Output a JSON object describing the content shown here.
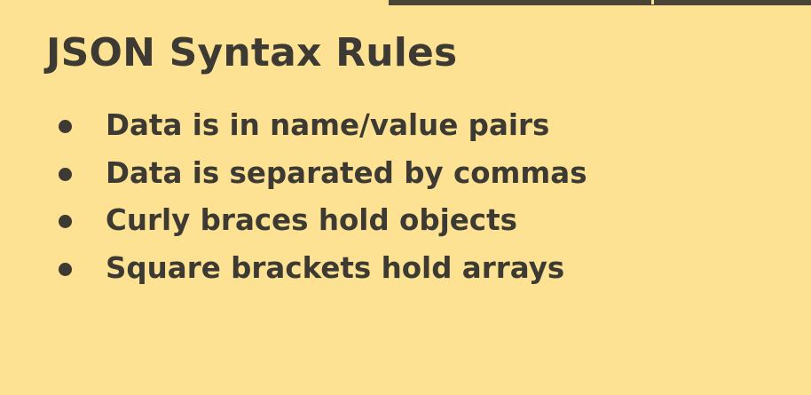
{
  "slide": {
    "title": "JSON Syntax Rules",
    "bullets": [
      "Data is in name/value pairs",
      "Data is separated by commas",
      "Curly braces hold objects",
      "Square brackets hold arrays"
    ],
    "colors": {
      "background": "#fde293",
      "text": "#3d3a33",
      "accent_bar": "#4a4536"
    }
  }
}
